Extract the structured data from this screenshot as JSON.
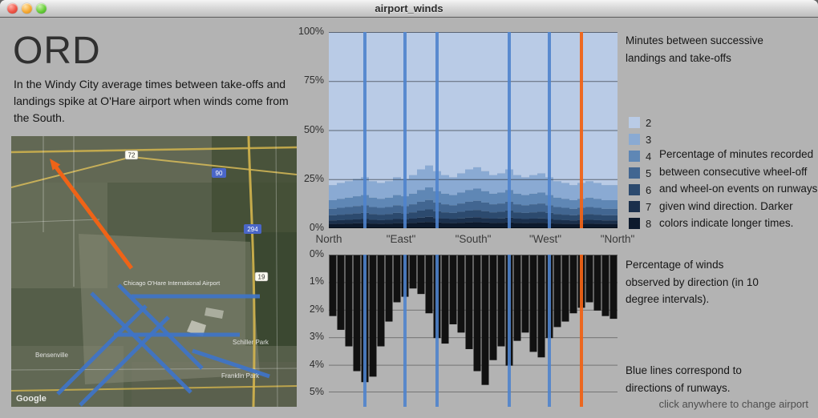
{
  "window": {
    "title": "airport_winds"
  },
  "left_panel": {
    "airport_code": "ORD",
    "description": "In the Windy City average times between take-offs and landings spike at O'Hare airport when winds come from the South.",
    "map": {
      "watermark": "Google",
      "airport_label": "Chicago O'Hare International Airport",
      "place_labels": [
        "Schiller Park",
        "Franklin Park",
        "Bensenville"
      ],
      "road_labels": [
        "72",
        "90",
        "294",
        "19"
      ]
    }
  },
  "annotations": {
    "top_right": "Minutes between successive landings and take-offs",
    "mid_right": "Percentage of minutes recorded between consecutive wheel-off and wheel-on events on runways given wind direction. Darker colors indicate longer times.",
    "winds": "Percentage of winds observed by direction (in 10 degree intervals).",
    "runways": "Blue lines correspond to directions of runways.",
    "footer": "click anywhere to change airport"
  },
  "colors": {
    "blue_runway_line": "#4f83cc",
    "orange_runway_line": "#ef6317",
    "wind_bar": "#111111",
    "window_background": "#b3b3b3"
  },
  "chart_data": [
    {
      "type": "area",
      "stacked": true,
      "title": "Minutes between successive landings and take-offs",
      "x_bins_degrees": [
        0,
        10,
        20,
        30,
        40,
        50,
        60,
        70,
        80,
        90,
        100,
        110,
        120,
        130,
        140,
        150,
        160,
        170,
        180,
        190,
        200,
        210,
        220,
        230,
        240,
        250,
        260,
        270,
        280,
        290,
        300,
        310,
        320,
        330,
        340,
        350
      ],
      "x_tick_labels": [
        "North",
        "\"East\"",
        "\"South\"",
        "\"West\"",
        "\"North\""
      ],
      "x_tick_degrees": [
        0,
        90,
        180,
        270,
        360
      ],
      "ylim": [
        0,
        100
      ],
      "y_ticks": [
        "100%",
        "75%",
        "50%",
        "25%",
        "0%"
      ],
      "y_grid_percent": [
        0,
        25,
        50,
        75,
        100
      ],
      "series": [
        {
          "name": "2",
          "color": "#b9cbe6",
          "values": [
            78,
            77,
            76,
            75,
            74,
            76,
            77,
            76,
            74,
            75,
            73,
            70,
            68,
            71,
            73,
            74,
            72,
            70,
            69,
            71,
            73,
            72,
            70,
            73,
            74,
            73,
            72,
            74,
            76,
            77,
            78,
            77,
            76,
            77,
            78,
            78
          ]
        },
        {
          "name": "3",
          "color": "#8aaad3",
          "values": [
            7.7,
            8.1,
            8.4,
            8.8,
            9.1,
            8.4,
            8.1,
            8.4,
            9.1,
            8.8,
            9.5,
            10.5,
            11.2,
            10.2,
            9.5,
            9.1,
            9.8,
            10.5,
            10.9,
            10.2,
            9.5,
            9.8,
            10.5,
            9.5,
            9.1,
            9.5,
            9.8,
            9.1,
            8.4,
            8.1,
            7.7,
            8.1,
            8.4,
            8.1,
            7.7,
            7.7
          ]
        },
        {
          "name": "4",
          "color": "#5f87b5",
          "values": [
            4.4,
            4.6,
            4.8,
            5.0,
            5.2,
            4.8,
            4.6,
            4.8,
            5.2,
            5.0,
            5.4,
            6.0,
            6.4,
            5.8,
            5.4,
            5.2,
            5.6,
            6.0,
            6.2,
            5.8,
            5.4,
            5.6,
            6.0,
            5.4,
            5.2,
            5.4,
            5.6,
            5.2,
            4.8,
            4.6,
            4.4,
            4.6,
            4.8,
            4.6,
            4.4,
            4.4
          ]
        },
        {
          "name": "5",
          "color": "#426691",
          "values": [
            3.3,
            3.5,
            3.6,
            3.8,
            3.9,
            3.6,
            3.5,
            3.6,
            3.9,
            3.8,
            4.1,
            4.5,
            4.8,
            4.4,
            4.1,
            3.9,
            4.2,
            4.5,
            4.7,
            4.4,
            4.1,
            4.2,
            4.5,
            4.1,
            3.9,
            4.1,
            4.2,
            3.9,
            3.6,
            3.5,
            3.3,
            3.5,
            3.6,
            3.5,
            3.3,
            3.3
          ]
        },
        {
          "name": "6",
          "color": "#2c4a6e",
          "values": [
            2.6,
            2.8,
            2.9,
            3.0,
            3.1,
            2.9,
            2.8,
            2.9,
            3.1,
            3.0,
            3.2,
            3.6,
            3.8,
            3.5,
            3.2,
            3.1,
            3.4,
            3.6,
            3.7,
            3.5,
            3.2,
            3.4,
            3.6,
            3.2,
            3.1,
            3.2,
            3.4,
            3.1,
            2.9,
            2.8,
            2.6,
            2.8,
            2.9,
            2.8,
            2.6,
            2.6
          ]
        },
        {
          "name": "7",
          "color": "#1b304c",
          "values": [
            1.8,
            1.8,
            1.9,
            2.0,
            2.1,
            1.9,
            1.8,
            1.9,
            2.1,
            2.0,
            2.2,
            2.4,
            2.6,
            2.3,
            2.2,
            2.1,
            2.2,
            2.4,
            2.5,
            2.3,
            2.2,
            2.2,
            2.4,
            2.2,
            2.1,
            2.2,
            2.2,
            2.1,
            1.9,
            1.8,
            1.8,
            1.8,
            1.9,
            1.8,
            1.8,
            1.8
          ]
        },
        {
          "name": "8",
          "color": "#0d1a2d",
          "values": [
            2.2,
            2.3,
            2.4,
            2.5,
            2.6,
            2.4,
            2.3,
            2.4,
            2.6,
            2.5,
            2.7,
            3.0,
            3.2,
            2.9,
            2.7,
            2.6,
            2.8,
            3.0,
            3.1,
            2.9,
            2.7,
            2.8,
            3.0,
            2.7,
            2.6,
            2.7,
            2.8,
            2.6,
            2.4,
            2.3,
            2.2,
            2.3,
            2.4,
            2.3,
            2.2,
            2.2
          ]
        }
      ],
      "runway_lines_degrees": {
        "blue": [
          45,
          95,
          135,
          225,
          275
        ],
        "orange": [
          315
        ]
      },
      "legend_position": "right"
    },
    {
      "type": "bar",
      "title": "Percentage of winds observed by direction (in 10 degree intervals).",
      "orientation": "inverted",
      "x_bins_degrees": [
        0,
        10,
        20,
        30,
        40,
        50,
        60,
        70,
        80,
        90,
        100,
        110,
        120,
        130,
        140,
        150,
        160,
        170,
        180,
        190,
        200,
        210,
        220,
        230,
        240,
        250,
        260,
        270,
        280,
        290,
        300,
        310,
        320,
        330,
        340,
        350
      ],
      "values": [
        2.2,
        2.7,
        3.3,
        4.2,
        4.6,
        4.4,
        3.3,
        2.4,
        1.7,
        1.5,
        1.2,
        1.4,
        2.1,
        3.0,
        3.2,
        2.5,
        2.8,
        3.4,
        4.2,
        4.7,
        3.8,
        3.3,
        4.0,
        3.1,
        2.8,
        3.5,
        3.7,
        3.0,
        2.6,
        2.4,
        2.1,
        1.9,
        1.7,
        2.0,
        2.2,
        2.3
      ],
      "ylim": [
        0,
        5
      ],
      "y_ticks": [
        "0%",
        "1%",
        "2%",
        "3%",
        "4%",
        "5%"
      ],
      "bar_color": "#111111",
      "runway_lines_degrees": {
        "blue": [
          45,
          95,
          135,
          225,
          275
        ],
        "orange": [
          315
        ]
      }
    }
  ]
}
